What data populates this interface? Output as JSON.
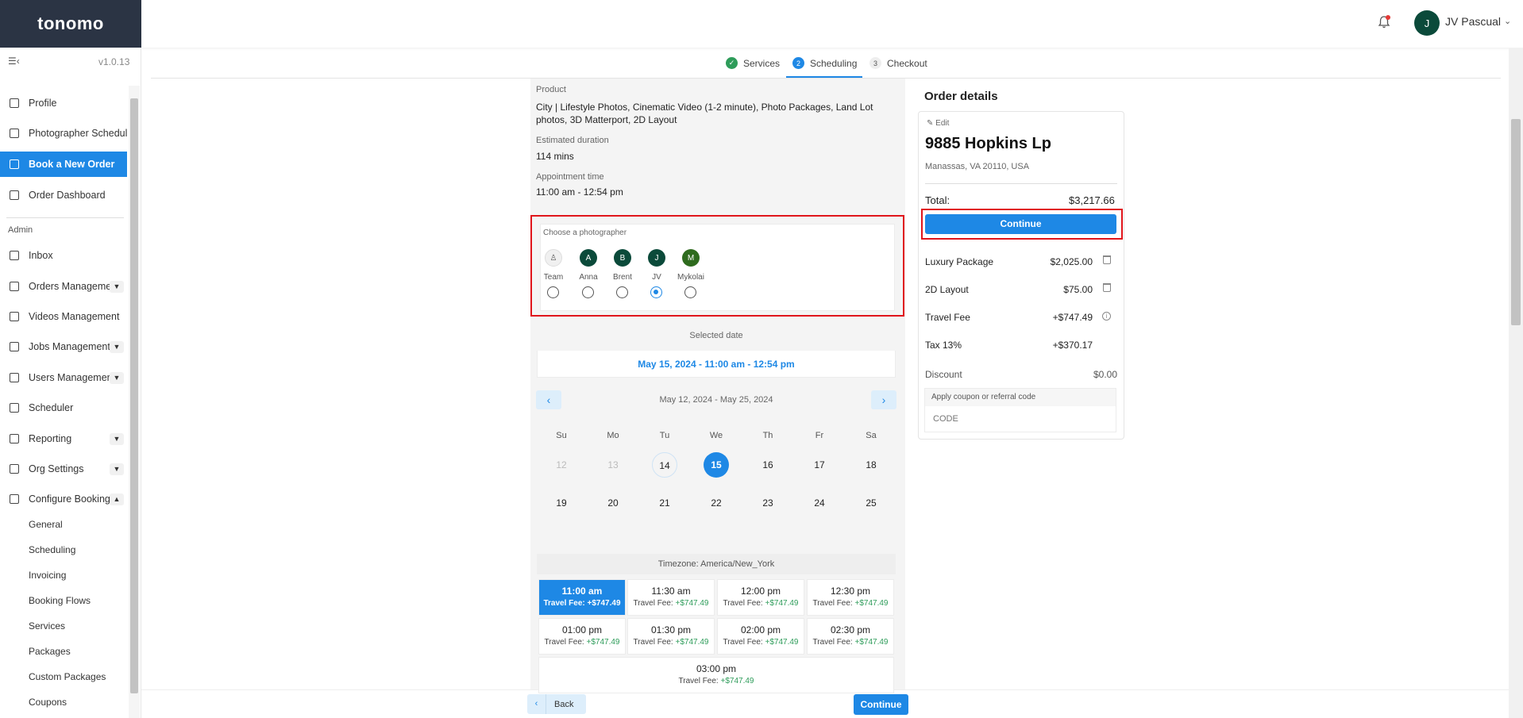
{
  "app": {
    "logo": "tonomo",
    "version": "v1.0.13"
  },
  "user": {
    "initial": "J",
    "name": "JV Pascual"
  },
  "sidebar": {
    "items": [
      {
        "label": "Profile"
      },
      {
        "label": "Photographer Schedule"
      },
      {
        "label": "Book a New Order"
      },
      {
        "label": "Order Dashboard"
      }
    ],
    "admin_label": "Admin",
    "admin_items": [
      {
        "label": "Inbox"
      },
      {
        "label": "Orders Management"
      },
      {
        "label": "Videos Management"
      },
      {
        "label": "Jobs Management"
      },
      {
        "label": "Users Management"
      },
      {
        "label": "Scheduler"
      },
      {
        "label": "Reporting"
      },
      {
        "label": "Org Settings"
      },
      {
        "label": "Configure Booking"
      }
    ],
    "sub_items": [
      "General",
      "Scheduling",
      "Invoicing",
      "Booking Flows",
      "Services",
      "Packages",
      "Custom Packages",
      "Coupons"
    ]
  },
  "steps": [
    {
      "num": "✓",
      "label": "Services"
    },
    {
      "num": "2",
      "label": "Scheduling"
    },
    {
      "num": "3",
      "label": "Checkout"
    }
  ],
  "summary": {
    "product_label": "Product",
    "product_line1": "City | Lifestyle Photos, Cinematic Video (1-2 minute), Photo Packages, Land Lot",
    "product_line2": "photos, 3D Matterport, 2D Layout",
    "duration_label": "Estimated duration",
    "duration": "114 mins",
    "appt_label": "Appointment time",
    "appt": "11:00 am - 12:54 pm"
  },
  "photographers": {
    "label": "Choose a photographer",
    "list": [
      {
        "initial": "",
        "name": "Team",
        "color": "#f0f0f0",
        "selected": false
      },
      {
        "initial": "A",
        "name": "Anna",
        "color": "#0b4a3a",
        "selected": false
      },
      {
        "initial": "B",
        "name": "Brent",
        "color": "#0b4a3a",
        "selected": false
      },
      {
        "initial": "J",
        "name": "JV",
        "color": "#0b4a3a",
        "selected": true
      },
      {
        "initial": "M",
        "name": "Mykolai",
        "color": "#2e6b1e",
        "selected": false
      }
    ]
  },
  "selected_date": {
    "label": "Selected date",
    "value": "May 15, 2024 - 11:00 am - 12:54 pm"
  },
  "calendar": {
    "range": "May 12, 2024 - May 25, 2024",
    "dow": [
      "Su",
      "Mo",
      "Tu",
      "We",
      "Th",
      "Fr",
      "Sa"
    ],
    "week1": [
      "12",
      "13",
      "14",
      "15",
      "16",
      "17",
      "18"
    ],
    "week2": [
      "19",
      "20",
      "21",
      "22",
      "23",
      "24",
      "25"
    ]
  },
  "timezone": "Timezone: America/New_York",
  "slots": [
    {
      "time": "11:00 am",
      "fee_label": "Travel Fee: ",
      "fee": "+$747.49"
    },
    {
      "time": "11:30 am",
      "fee_label": "Travel Fee: ",
      "fee": "+$747.49"
    },
    {
      "time": "12:00 pm",
      "fee_label": "Travel Fee: ",
      "fee": "+$747.49"
    },
    {
      "time": "12:30 pm",
      "fee_label": "Travel Fee: ",
      "fee": "+$747.49"
    },
    {
      "time": "01:00 pm",
      "fee_label": "Travel Fee: ",
      "fee": "+$747.49"
    },
    {
      "time": "01:30 pm",
      "fee_label": "Travel Fee: ",
      "fee": "+$747.49"
    },
    {
      "time": "02:00 pm",
      "fee_label": "Travel Fee: ",
      "fee": "+$747.49"
    },
    {
      "time": "02:30 pm",
      "fee_label": "Travel Fee: ",
      "fee": "+$747.49"
    },
    {
      "time": "03:00 pm",
      "fee_label": "Travel Fee: ",
      "fee": "+$747.49"
    }
  ],
  "bottom": {
    "back": "Back",
    "continue": "Continue"
  },
  "order": {
    "title": "Order details",
    "edit": "Edit",
    "address": "9885 Hopkins Lp",
    "city": "Manassas, VA 20110, USA",
    "total_label": "Total:",
    "total": "$3,217.66",
    "continue": "Continue",
    "lines": [
      {
        "label": "Luxury Package",
        "value": "$2,025.00"
      },
      {
        "label": "2D Layout",
        "value": "$75.00"
      },
      {
        "label": "Travel Fee",
        "value": "+$747.49"
      },
      {
        "label": "Tax 13%",
        "value": "+$370.17"
      }
    ],
    "discount_label": "Discount",
    "discount": "$0.00",
    "coupon_label": "Apply coupon or referral code",
    "coupon_placeholder": "CODE"
  },
  "colors": {
    "accent": "#1e88e5",
    "sidebar_dark": "#2b3444",
    "highlight": "#e0151b",
    "fee_green": "#2e9c5a"
  }
}
